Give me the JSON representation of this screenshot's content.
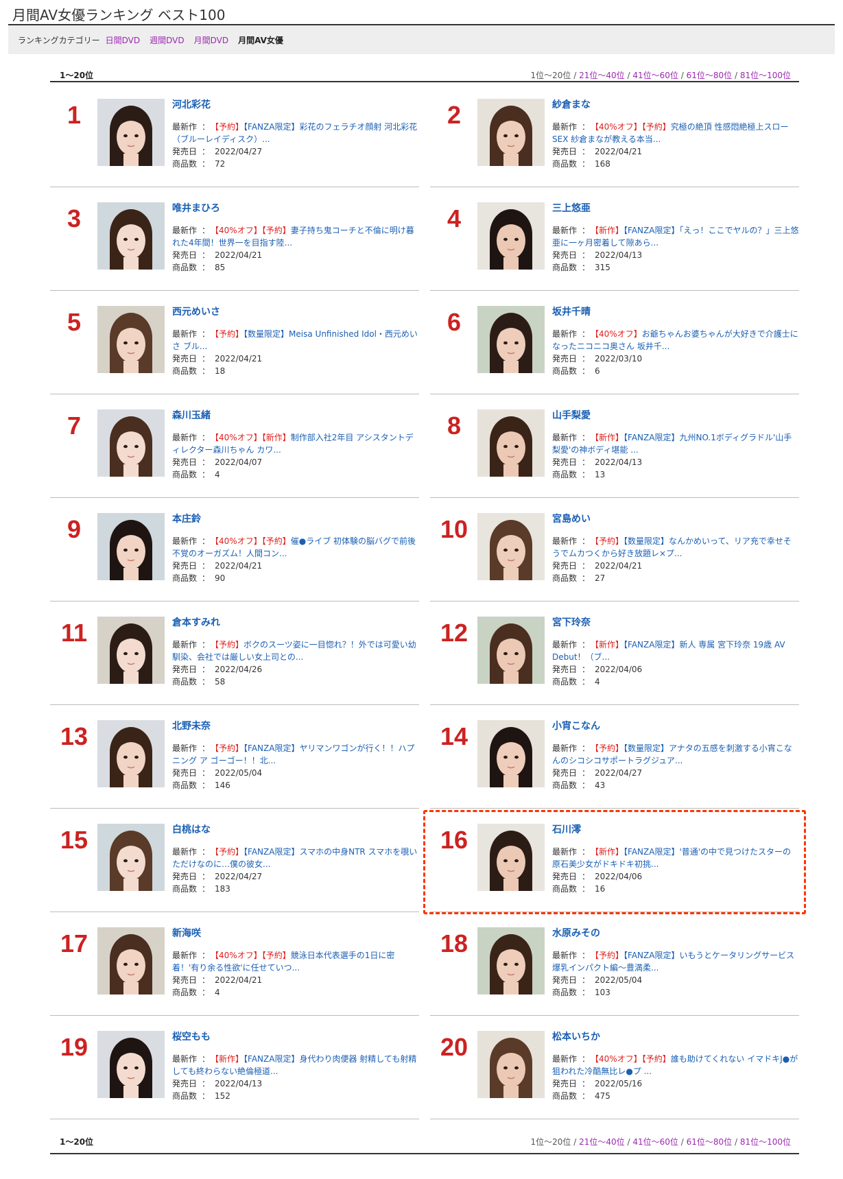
{
  "page": {
    "title": "月間AV女優ランキング ベスト100"
  },
  "category_bar": {
    "label": "ランキングカテゴリー",
    "links": [
      "日間DVD",
      "週間DVD",
      "月間DVD"
    ],
    "current": "月間AV女優"
  },
  "pager": {
    "range": "1〜20位",
    "current": "1位〜20位",
    "links": [
      "21位〜40位",
      "41位〜60位",
      "61位〜80位",
      "81位〜100位"
    ],
    "separator": "/"
  },
  "labels": {
    "latest": "最新作",
    "release": "発売日",
    "count": "商品数",
    "colon": "："
  },
  "entries": [
    {
      "rank": "1",
      "name": "河北彩花",
      "tags": [
        "【予約】"
      ],
      "product": "【FANZA限定】彩花のフェラチオ顔射 河北彩花（ブルーレイディスク）...",
      "date": "2022/04/27",
      "count": "72"
    },
    {
      "rank": "2",
      "name": "紗倉まな",
      "tags": [
        "【40%オフ】",
        "【予約】"
      ],
      "product": "究極の絶頂 性感悶絶極上スローSEX 紗倉まなが教える本当...",
      "date": "2022/04/21",
      "count": "168"
    },
    {
      "rank": "3",
      "name": "唯井まひろ",
      "tags": [
        "【40%オフ】",
        "【予約】"
      ],
      "product": "妻子持ち鬼コーチと不倫に明け暮れた4年間！世界一を目指す陸...",
      "date": "2022/04/21",
      "count": "85"
    },
    {
      "rank": "4",
      "name": "三上悠亜",
      "tags": [
        "【新作】"
      ],
      "product": "【FANZA限定】「えっ！ここでヤルの？」三上悠亜に一ヶ月密着して隙あら...",
      "date": "2022/04/13",
      "count": "315"
    },
    {
      "rank": "5",
      "name": "西元めいさ",
      "tags": [
        "【予約】"
      ],
      "product": "【数量限定】Meisa Unfinished Idol・西元めいさ ブル...",
      "date": "2022/04/21",
      "count": "18"
    },
    {
      "rank": "6",
      "name": "坂井千晴",
      "tags": [
        "【40%オフ】"
      ],
      "product": "お爺ちゃんお婆ちゃんが大好きで介護士になったニコニコ奥さん 坂井千...",
      "date": "2022/03/10",
      "count": "6"
    },
    {
      "rank": "7",
      "name": "森川玉緒",
      "tags": [
        "【40%オフ】",
        "【新作】"
      ],
      "product": "制作部入社2年目 アシスタントディレクター森川ちゃん カワ...",
      "date": "2022/04/07",
      "count": "4"
    },
    {
      "rank": "8",
      "name": "山手梨愛",
      "tags": [
        "【新作】"
      ],
      "product": "【FANZA限定】九州NO.1ボディグラドル'山手梨愛'の神ボディ堪能 ...",
      "date": "2022/04/13",
      "count": "13"
    },
    {
      "rank": "9",
      "name": "本庄鈴",
      "tags": [
        "【40%オフ】",
        "【予約】"
      ],
      "product": "催●ライブ 初体験の脳バグで前後不覚のオーガズム！人間コン...",
      "date": "2022/04/21",
      "count": "90"
    },
    {
      "rank": "10",
      "name": "宮島めい",
      "tags": [
        "【予約】"
      ],
      "product": "【数量限定】なんかめいって、リア充で幸せそうでムカつくから好き放題レ×プ...",
      "date": "2022/04/21",
      "count": "27"
    },
    {
      "rank": "11",
      "name": "倉本すみれ",
      "tags": [
        "【予約】"
      ],
      "product": "ボクのスーツ姿に一目惚れ？！外では可愛い幼馴染、会社では厳しい女上司との...",
      "date": "2022/04/26",
      "count": "58"
    },
    {
      "rank": "12",
      "name": "宮下玲奈",
      "tags": [
        "【新作】"
      ],
      "product": "【FANZA限定】新人 専属 宮下玲奈 19歳 AV Debut！（ブ...",
      "date": "2022/04/06",
      "count": "4"
    },
    {
      "rank": "13",
      "name": "北野未奈",
      "tags": [
        "【予約】"
      ],
      "product": "【FANZA限定】ヤリマンワゴンが行く！！ハプニング ア ゴーゴー！！北...",
      "date": "2022/05/04",
      "count": "146"
    },
    {
      "rank": "14",
      "name": "小宵こなん",
      "tags": [
        "【予約】"
      ],
      "product": "【数量限定】アナタの五感を刺激する小宵こなんのシコシコサポートラグジュア...",
      "date": "2022/04/27",
      "count": "43"
    },
    {
      "rank": "15",
      "name": "白桃はな",
      "tags": [
        "【予約】"
      ],
      "product": "【FANZA限定】スマホの中身NTR スマホを覗いただけなのに…僕の彼女...",
      "date": "2022/04/27",
      "count": "183"
    },
    {
      "rank": "16",
      "name": "石川澪",
      "tags": [
        "【新作】"
      ],
      "product": "【FANZA限定】'普通'の中で見つけたスターの原石美少女がドキドキ初挑...",
      "date": "2022/04/06",
      "count": "16"
    },
    {
      "rank": "17",
      "name": "新海咲",
      "tags": [
        "【40%オフ】",
        "【予約】"
      ],
      "product": "競泳日本代表選手の1日に密着！'有り余る性欲'に任せていつ...",
      "date": "2022/04/21",
      "count": "4"
    },
    {
      "rank": "18",
      "name": "水原みその",
      "tags": [
        "【予約】"
      ],
      "product": "【FANZA限定】いもうとケータリングサービス 爆乳インパクト編〜豊満柔...",
      "date": "2022/05/04",
      "count": "103"
    },
    {
      "rank": "19",
      "name": "桜空もも",
      "tags": [
        "【新作】"
      ],
      "product": "【FANZA限定】身代わり肉便器 射精しても射精しても終わらない絶倫極道...",
      "date": "2022/04/13",
      "count": "152"
    },
    {
      "rank": "20",
      "name": "松本いちか",
      "tags": [
        "【40%オフ】",
        "【予約】"
      ],
      "product": "誰も助けてくれない イマドキJ●が狙われた冷酷無比レ●プ ...",
      "date": "2022/05/16",
      "count": "475"
    }
  ],
  "colors": {
    "rank": "#cc2222",
    "link": "#1a5fb4",
    "tag": "#e0201e",
    "pager_link": "#9c27b0",
    "highlight": "#ff3300"
  }
}
